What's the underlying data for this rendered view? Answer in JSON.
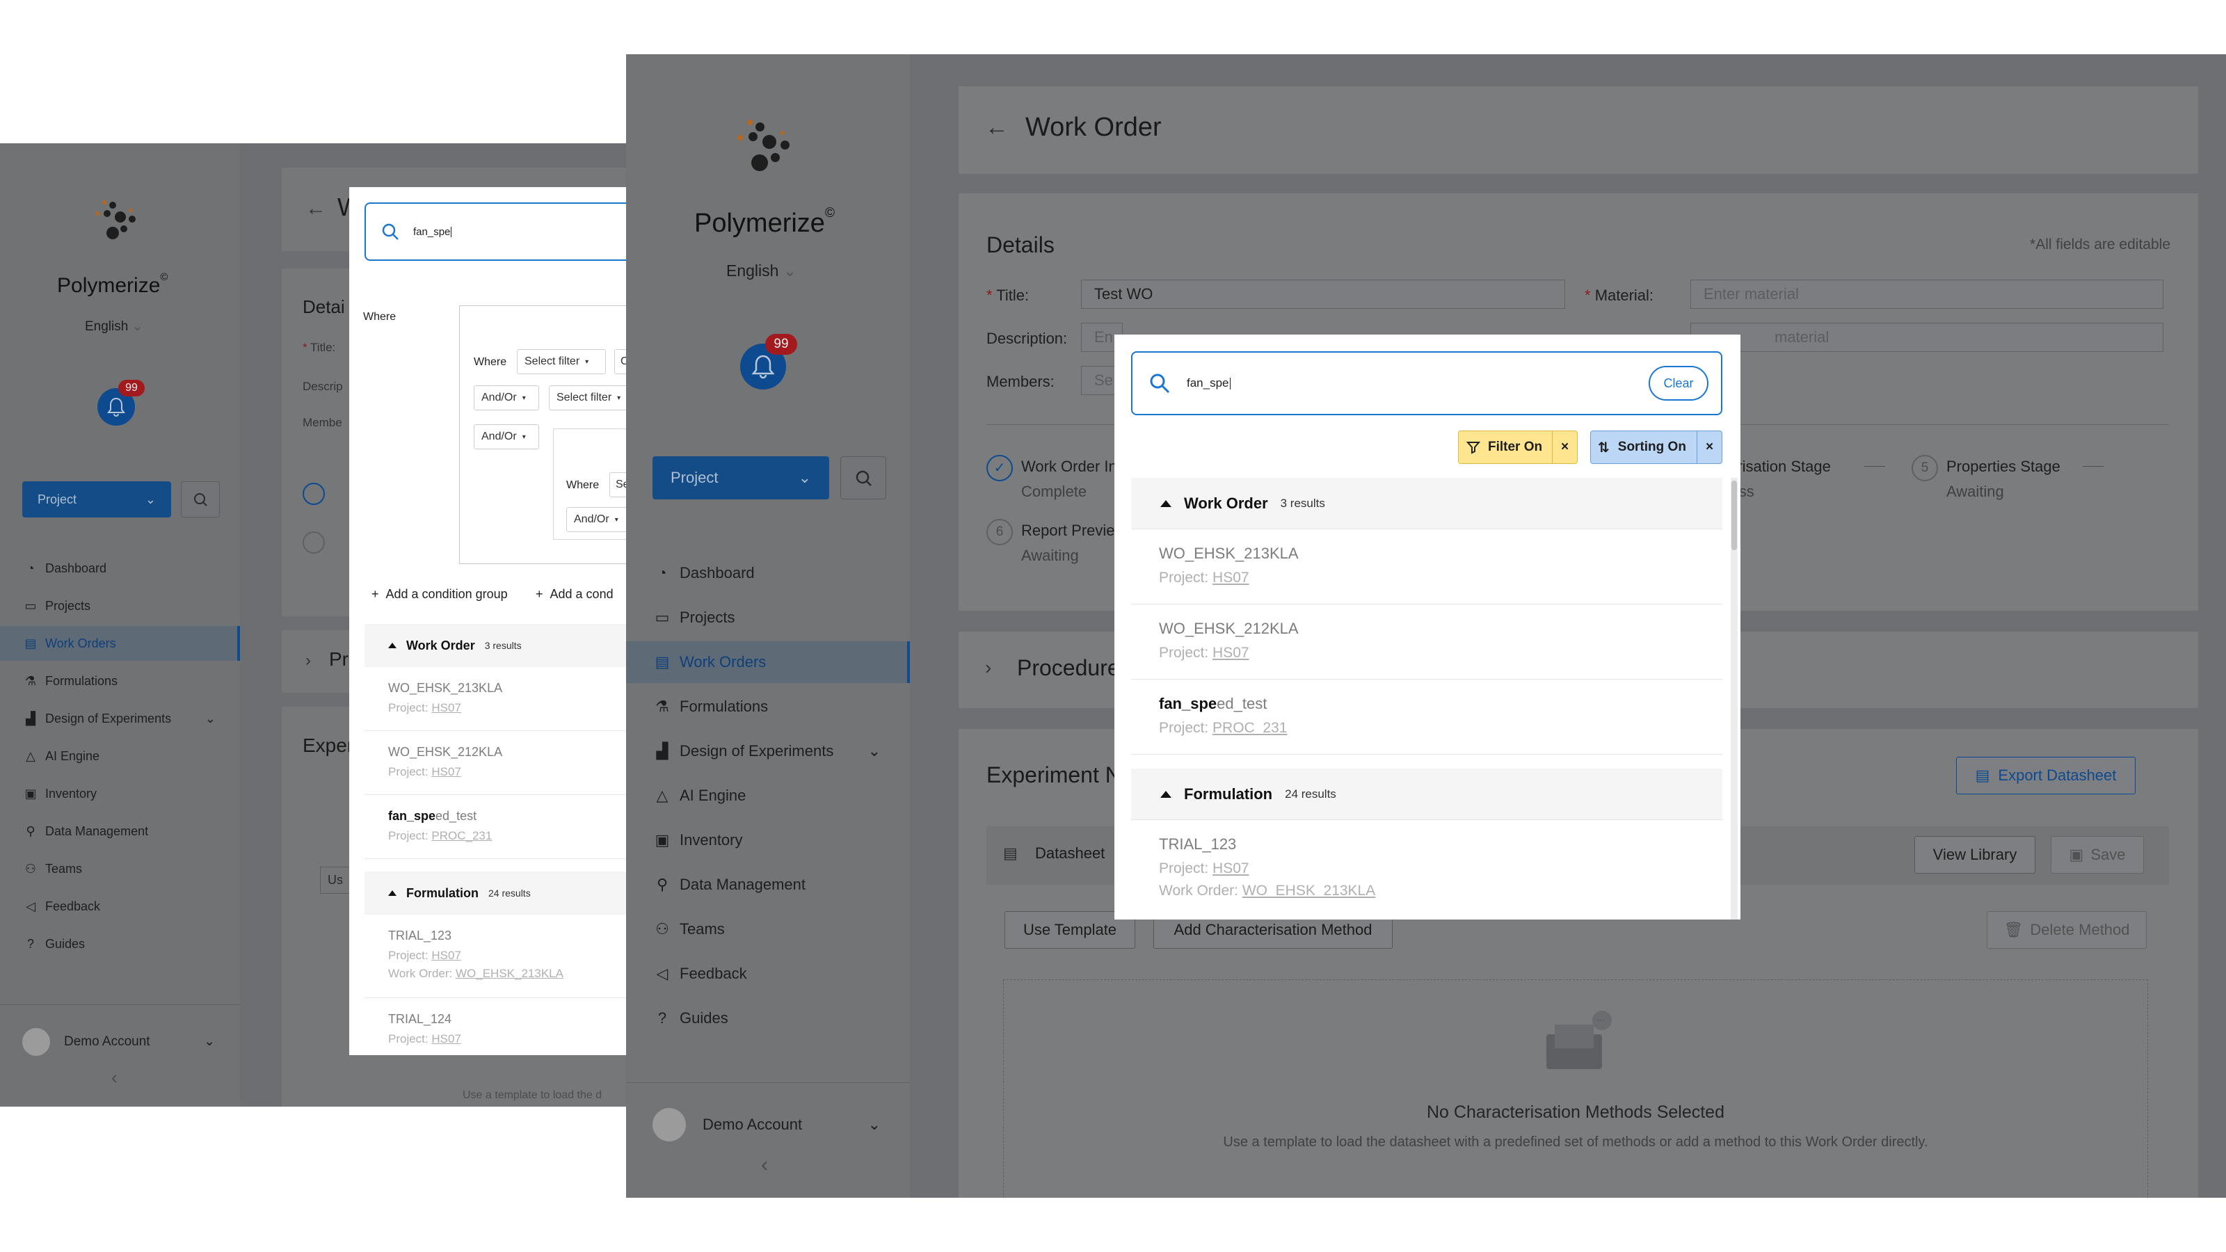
{
  "app": {
    "brand": "Polymerize",
    "brand_mark": "©",
    "language": "English",
    "notifications_badge": "99",
    "project_button": "Project",
    "account": "Demo Account"
  },
  "nav": [
    {
      "label": "Dashboard",
      "icon": "dashboard-icon"
    },
    {
      "label": "Projects",
      "icon": "folder-icon"
    },
    {
      "label": "Work Orders",
      "icon": "work-order-icon",
      "active": true
    },
    {
      "label": "Formulations",
      "icon": "flask-icon"
    },
    {
      "label": "Design of Experiments",
      "icon": "chart-icon",
      "expandable": true
    },
    {
      "label": "AI Engine",
      "icon": "warning-triangle-icon"
    },
    {
      "label": "Inventory",
      "icon": "inventory-icon"
    },
    {
      "label": "Data Management",
      "icon": "data-management-icon"
    },
    {
      "label": "Teams",
      "icon": "teams-icon"
    },
    {
      "label": "Feedback",
      "icon": "feedback-icon"
    },
    {
      "label": "Guides",
      "icon": "question-icon"
    }
  ],
  "page": {
    "title": "Work Order",
    "details_heading": "Details",
    "editable_note": "*All fields are editable",
    "title_label": "Title:",
    "title_value": "Test WO",
    "material_label": "Material:",
    "material_placeholder": "Enter material",
    "description_label": "Description:",
    "description_placeholder_partial": "En",
    "members_label": "Members:",
    "members_placeholder_partial": "Se",
    "material2_placeholder_partial": "material",
    "stages": [
      {
        "name": "Work Order In",
        "status": "Complete",
        "num": "✓"
      },
      {
        "name": "cterisation Stage",
        "status": "gress",
        "num": ""
      },
      {
        "name": "Properties Stage",
        "status": "Awaiting",
        "num": "5"
      },
      {
        "name": "Report Previe",
        "status": "Awaiting",
        "num": "6"
      }
    ],
    "procedure_heading": "Procedure",
    "experiment_heading": "Experiment N",
    "export_button": "Export Datasheet",
    "datasheet_tab": "Datasheet",
    "view_library": "View Library",
    "save": "Save",
    "use_template": "Use Template",
    "add_method": "Add Characterisation Method",
    "delete_method": "Delete Method",
    "empty_title": "No Characterisation Methods Selected",
    "empty_desc": "Use a template to load the datasheet with a predefined set of methods or add a method to this Work Order directly.",
    "left_empty_desc_partial": "Use a template to load the d",
    "left_use_partial": "Us"
  },
  "search": {
    "query": "fan_spe",
    "clear": "Clear",
    "filter_chip": "Filter On",
    "sorting_chip": "Sorting On",
    "groups": [
      {
        "name": "Work Order",
        "count": "3 results",
        "items": [
          {
            "title": "WO_EHSK_213KLA",
            "meta_label": "Project:",
            "meta_link": "HS07"
          },
          {
            "title": "WO_EHSK_212KLA",
            "meta_label": "Project:",
            "meta_link": "HS07"
          },
          {
            "title_bold": "fan_spe",
            "title_rest": "ed_test",
            "meta_label": "Project:",
            "meta_link": "PROC_231"
          }
        ]
      },
      {
        "name": "Formulation",
        "count": "24 results",
        "items": [
          {
            "title": "TRIAL_123",
            "meta_label": "Project:",
            "meta_link": "HS07",
            "meta2_label": "Work Order:",
            "meta2_link": "WO_EHSK_213KLA"
          },
          {
            "title": "TRIAL_124",
            "meta_label": "Project:",
            "meta_link": "HS07"
          }
        ]
      }
    ]
  },
  "filter_builder": {
    "where": "Where",
    "select_filter": "Select filter",
    "and_or": "And/Or",
    "partial_c": "C",
    "partial_s": "Se",
    "add_group": "Add a condition group",
    "add_condition_partial": "Add a cond"
  },
  "colors": {
    "accent": "#1976d2",
    "filter_chip_bg": "#ffe58f",
    "sorting_chip_bg": "#bcd6f5",
    "badge": "#a2191e",
    "brand_orange": "#b5691f"
  }
}
